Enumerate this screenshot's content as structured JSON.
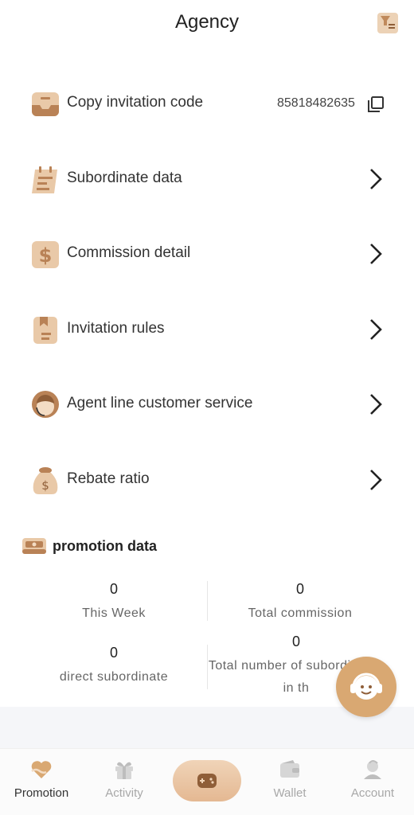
{
  "header": {
    "title": "Agency",
    "corner_icon": "agency-doc-icon"
  },
  "menu": {
    "items": [
      {
        "label": "Copy invitation code",
        "value": "85818482635",
        "icon": "inbox-tray-icon",
        "action_icon": "copy-icon"
      },
      {
        "label": "Subordinate data",
        "icon": "calendar-notes-icon",
        "action_icon": "chevron-right-icon"
      },
      {
        "label": "Commission detail",
        "icon": "dollar-icon",
        "action_icon": "chevron-right-icon"
      },
      {
        "label": "Invitation rules",
        "icon": "bookmark-doc-icon",
        "action_icon": "chevron-right-icon"
      },
      {
        "label": "Agent line customer service",
        "icon": "agent-avatar-icon",
        "action_icon": "chevron-right-icon"
      },
      {
        "label": "Rebate ratio",
        "icon": "money-bag-icon",
        "action_icon": "chevron-right-icon"
      }
    ]
  },
  "promotion": {
    "title": "promotion data",
    "icon": "wallet-cash-icon",
    "stats": [
      {
        "value": "0",
        "label": "This Week"
      },
      {
        "value": "0",
        "label": "Total commission"
      },
      {
        "value": "0",
        "label": "direct subordinate"
      },
      {
        "value": "0",
        "label": "Total number of subordinates in th"
      }
    ]
  },
  "float_button": {
    "icon": "headset-support-icon"
  },
  "tabbar": {
    "tabs": [
      {
        "label": "Promotion",
        "icon": "promotion-heart-icon",
        "active": true
      },
      {
        "label": "Activity",
        "icon": "gift-icon",
        "active": false
      },
      {
        "label": "",
        "icon": "gamepad-icon",
        "active": false
      },
      {
        "label": "Wallet",
        "icon": "wallet-icon",
        "active": false
      },
      {
        "label": "Account",
        "icon": "account-icon",
        "active": false
      }
    ]
  },
  "colors": {
    "accent": "#d9a872",
    "accent_light": "#f0d4b8",
    "icon_bg": "#e9c9a8",
    "icon_dark": "#b98256",
    "inactive": "#a8a8a8"
  }
}
